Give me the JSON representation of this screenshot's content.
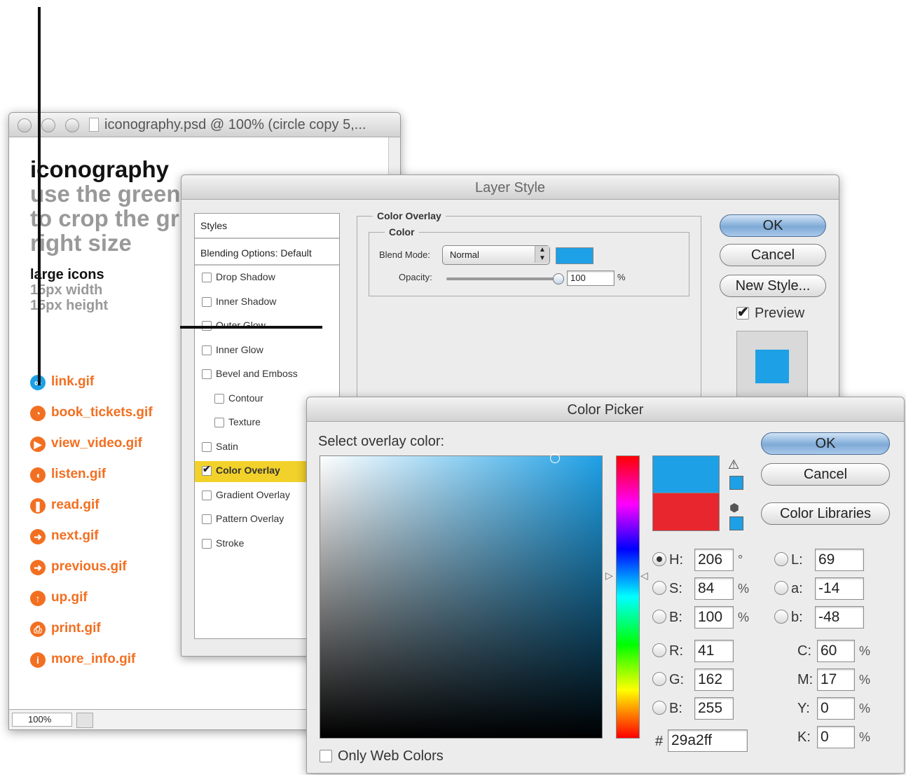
{
  "doc_window": {
    "title": "iconography.psd @ 100% (circle copy 5,...",
    "heading": "iconography",
    "subtitle_lines": [
      "use the green",
      "to crop the gr",
      "right size"
    ],
    "section_title": "large icons",
    "section_lines": [
      "15px width",
      "15px height"
    ],
    "icons": [
      {
        "name": "link.gif",
        "color": "#1ea0e6"
      },
      {
        "name": "book_tickets.gif",
        "color": "#f26f21"
      },
      {
        "name": "view_video.gif",
        "color": "#f26f21"
      },
      {
        "name": "listen.gif",
        "color": "#f26f21"
      },
      {
        "name": "read.gif",
        "color": "#f26f21"
      },
      {
        "name": "next.gif",
        "color": "#f26f21"
      },
      {
        "name": "previous.gif",
        "color": "#f26f21"
      },
      {
        "name": "up.gif",
        "color": "#f26f21"
      },
      {
        "name": "print.gif",
        "color": "#f26f21"
      },
      {
        "name": "more_info.gif",
        "color": "#f26f21"
      }
    ],
    "zoom": "100%"
  },
  "layer_style": {
    "title": "Layer Style",
    "styles_header": "Styles",
    "blending_options": "Blending Options: Default",
    "items": [
      {
        "label": "Drop Shadow",
        "checked": false,
        "indent": false
      },
      {
        "label": "Inner Shadow",
        "checked": false,
        "indent": false
      },
      {
        "label": "Outer Glow",
        "checked": false,
        "indent": false
      },
      {
        "label": "Inner Glow",
        "checked": false,
        "indent": false
      },
      {
        "label": "Bevel and Emboss",
        "checked": false,
        "indent": false
      },
      {
        "label": "Contour",
        "checked": false,
        "indent": true
      },
      {
        "label": "Texture",
        "checked": false,
        "indent": true
      },
      {
        "label": "Satin",
        "checked": false,
        "indent": false
      },
      {
        "label": "Color Overlay",
        "checked": true,
        "indent": false,
        "selected": true
      },
      {
        "label": "Gradient Overlay",
        "checked": false,
        "indent": false
      },
      {
        "label": "Pattern Overlay",
        "checked": false,
        "indent": false
      },
      {
        "label": "Stroke",
        "checked": false,
        "indent": false
      }
    ],
    "group_title": "Color Overlay",
    "subgroup_title": "Color",
    "blend_mode_label": "Blend Mode:",
    "blend_mode_value": "Normal",
    "overlay_color": "#1ea0e6",
    "opacity_label": "Opacity:",
    "opacity_value": "100",
    "opacity_unit": "%",
    "ok_label": "OK",
    "cancel_label": "Cancel",
    "new_style_label": "New Style...",
    "preview_label": "Preview",
    "preview_checked": true,
    "selected_color": "#f2d12a"
  },
  "color_picker": {
    "title": "Color Picker",
    "prompt": "Select overlay color:",
    "ok_label": "OK",
    "cancel_label": "Cancel",
    "libraries_label": "Color Libraries",
    "new_color": "#1ea0e6",
    "current_color": "#e8262d",
    "hsb": [
      {
        "label": "H:",
        "value": "206",
        "unit": "°",
        "selected": true
      },
      {
        "label": "S:",
        "value": "84",
        "unit": "%",
        "selected": false
      },
      {
        "label": "B:",
        "value": "100",
        "unit": "%",
        "selected": false
      }
    ],
    "rgb": [
      {
        "label": "R:",
        "value": "41"
      },
      {
        "label": "G:",
        "value": "162"
      },
      {
        "label": "B:",
        "value": "255"
      }
    ],
    "lab": [
      {
        "label": "L:",
        "value": "69"
      },
      {
        "label": "a:",
        "value": "-14"
      },
      {
        "label": "b:",
        "value": "-48"
      }
    ],
    "cmyk": [
      {
        "label": "C:",
        "value": "60",
        "unit": "%"
      },
      {
        "label": "M:",
        "value": "17",
        "unit": "%"
      },
      {
        "label": "Y:",
        "value": "0",
        "unit": "%"
      },
      {
        "label": "K:",
        "value": "0",
        "unit": "%"
      }
    ],
    "hex_label": "#",
    "hex_value": "29a2ff",
    "web_colors_label": "Only Web Colors"
  }
}
